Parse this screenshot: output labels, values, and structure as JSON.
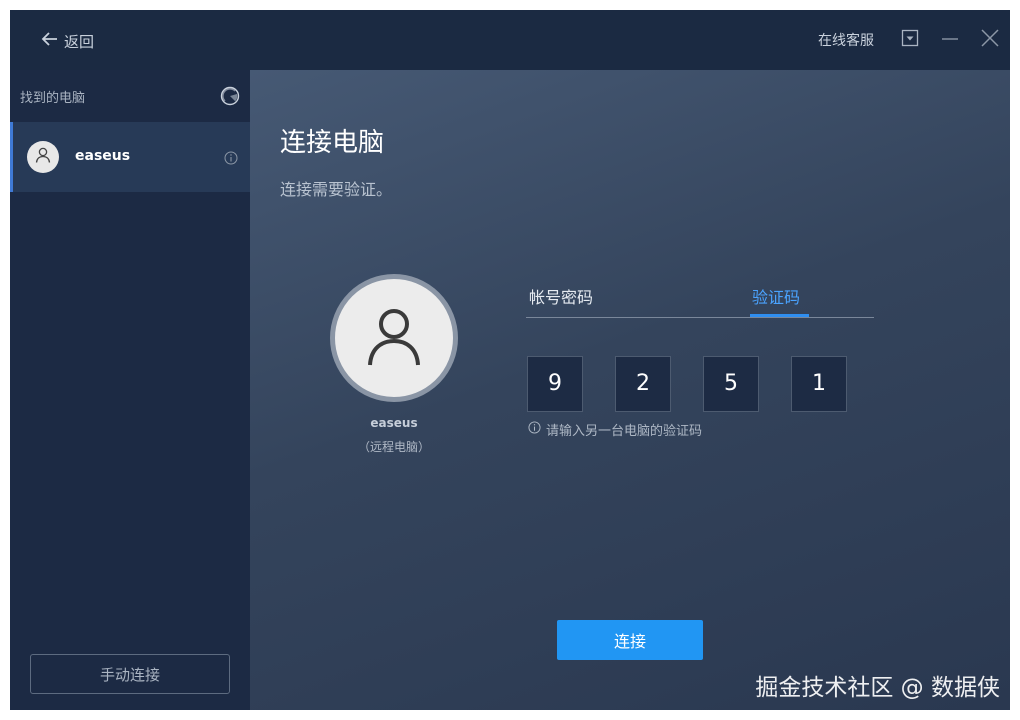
{
  "titlebar": {
    "back_label": "返回",
    "support_label": "在线客服"
  },
  "sidebar": {
    "header": "找到的电脑",
    "devices": [
      {
        "name": "easeus"
      }
    ],
    "manual_connect_label": "手动连接"
  },
  "main": {
    "title": "连接电脑",
    "subtitle": "连接需要验证。",
    "remote": {
      "name": "easeus",
      "type": "（远程电脑）"
    },
    "tabs": [
      {
        "label": "帐号密码",
        "active": false
      },
      {
        "label": "验证码",
        "active": true
      }
    ],
    "code_digits": [
      "9",
      "2",
      "5",
      "1"
    ],
    "hint": "请输入另一台电脑的验证码",
    "connect_label": "连接"
  },
  "watermark": "掘金技术社区 @ 数据侠",
  "colors": {
    "accent": "#2196f3",
    "tab_active": "#4aa3ff",
    "titlebar_bg": "#1b2a42",
    "sidebar_bg": "#1c2a44"
  },
  "icons": [
    "arrow-left-icon",
    "dropdown-icon",
    "minimize-icon",
    "close-icon",
    "refresh-icon",
    "user-icon",
    "info-icon"
  ]
}
